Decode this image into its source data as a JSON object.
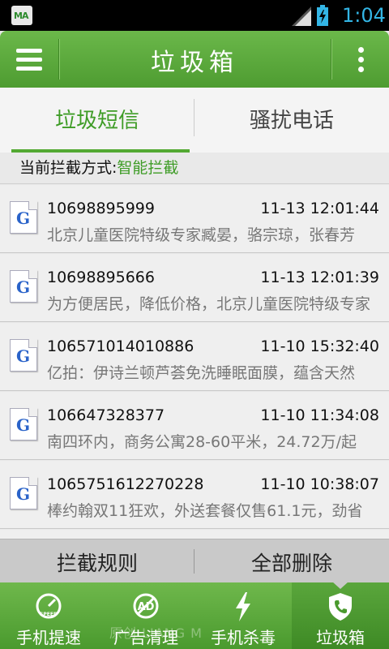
{
  "status_bar": {
    "time": "1:04",
    "app_icon_text": "MA"
  },
  "title_bar": {
    "title": "垃圾箱"
  },
  "tabs": [
    {
      "label": "垃圾短信",
      "active": true
    },
    {
      "label": "骚扰电话",
      "active": false
    }
  ],
  "intercept_mode": {
    "label": "当前拦截方式:",
    "value": "智能拦截"
  },
  "messages": [
    {
      "number": "10698895999",
      "time": "11-13 12:01:44",
      "preview": "北京儿童医院特级专家臧晏，骆宗琼，张春芳"
    },
    {
      "number": "10698895666",
      "time": "11-13 12:01:39",
      "preview": "为方便居民，降低价格，北京儿童医院特级专家"
    },
    {
      "number": "106571014010886",
      "time": "11-10 15:32:40",
      "preview": "亿拍：伊诗兰顿芦荟免洗睡眠面膜，蕴含天然"
    },
    {
      "number": "106647328377",
      "time": "11-10 11:34:08",
      "preview": "南四环内，商务公寓28-60平米，24.72万/起"
    },
    {
      "number": "1065751612270228",
      "time": "11-10 10:38:07",
      "preview": "棒约翰双11狂欢，外送套餐仅售61.1元，劲省"
    }
  ],
  "actions": {
    "rules": "拦截规则",
    "delete_all": "全部删除"
  },
  "bottom_nav": [
    {
      "label": "手机提速",
      "icon": "speedometer-icon",
      "icon_text": "SPEED"
    },
    {
      "label": "广告清理",
      "icon": "no-ad-icon",
      "icon_text": "AD"
    },
    {
      "label": "手机杀毒",
      "icon": "lightning-icon"
    },
    {
      "label": "垃圾箱",
      "icon": "shield-phone-icon",
      "active": true
    }
  ],
  "watermark": "原创   LIANG   M",
  "colors": {
    "accent": "#53a932",
    "status_time": "#33b5e5",
    "number_g": "#2a63c9"
  }
}
